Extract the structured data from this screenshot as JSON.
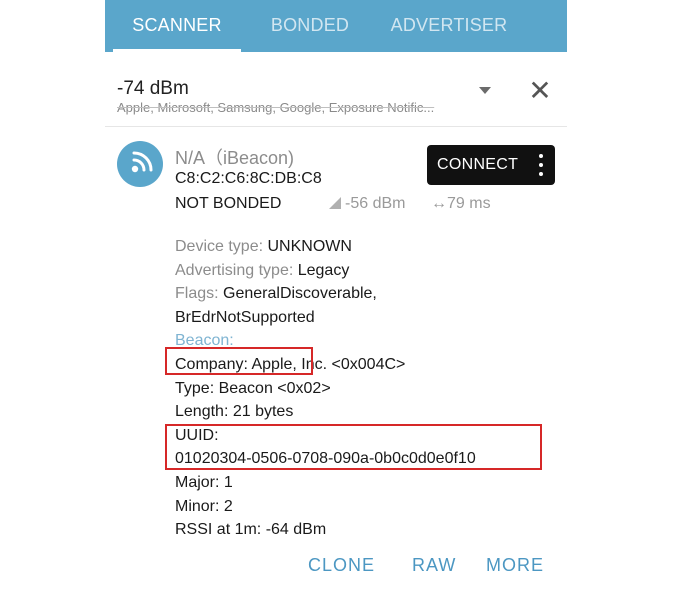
{
  "tabs": [
    {
      "label": "SCANNER",
      "active": true
    },
    {
      "label": "BONDED",
      "active": false
    },
    {
      "label": "ADVERTISER",
      "active": false
    }
  ],
  "filter": {
    "value": "-74 dBm",
    "subtitle": "Apple, Microsoft, Samsung, Google, Exposure Notific..."
  },
  "device": {
    "name": "N/A（iBeacon)",
    "address": "C8:C2:C6:8C:DB:C8",
    "bond_state": "NOT BONDED",
    "rssi": "-56 dBm",
    "interval": "79 ms",
    "connect_label": "CONNECT",
    "details": {
      "device_type_label": "Device type: ",
      "device_type_value": "UNKNOWN",
      "adv_type_label": "Advertising type: ",
      "adv_type_value": "Legacy",
      "flags_label": "Flags: ",
      "flags_value_1": "GeneralDiscoverable,",
      "flags_value_2": "BrEdrNotSupported",
      "beacon_header": "Beacon:",
      "company": "Company: Apple, Inc. <0x004C>",
      "type": "Type: Beacon <0x02>",
      "length": "Length: 21 bytes",
      "uuid_label": "UUID:",
      "uuid_value": "01020304-0506-0708-090a-0b0c0d0e0f10",
      "major": "Major: 1",
      "minor": "Minor: 2",
      "rssi_1m": "RSSI at 1m: -64 dBm"
    }
  },
  "actions": {
    "clone": "CLONE",
    "raw": "RAW",
    "more": "MORE"
  },
  "colors": {
    "accent": "#5aa6cb",
    "highlight": "#d62828",
    "action_text": "#4c97c2"
  },
  "icons": {
    "device": "wifi-broadcast-icon",
    "signal": "signal-strength-icon",
    "interval": "left-right-arrow-icon",
    "close": "close-icon",
    "dropdown": "chevron-down-icon",
    "overflow": "more-vertical-icon"
  }
}
